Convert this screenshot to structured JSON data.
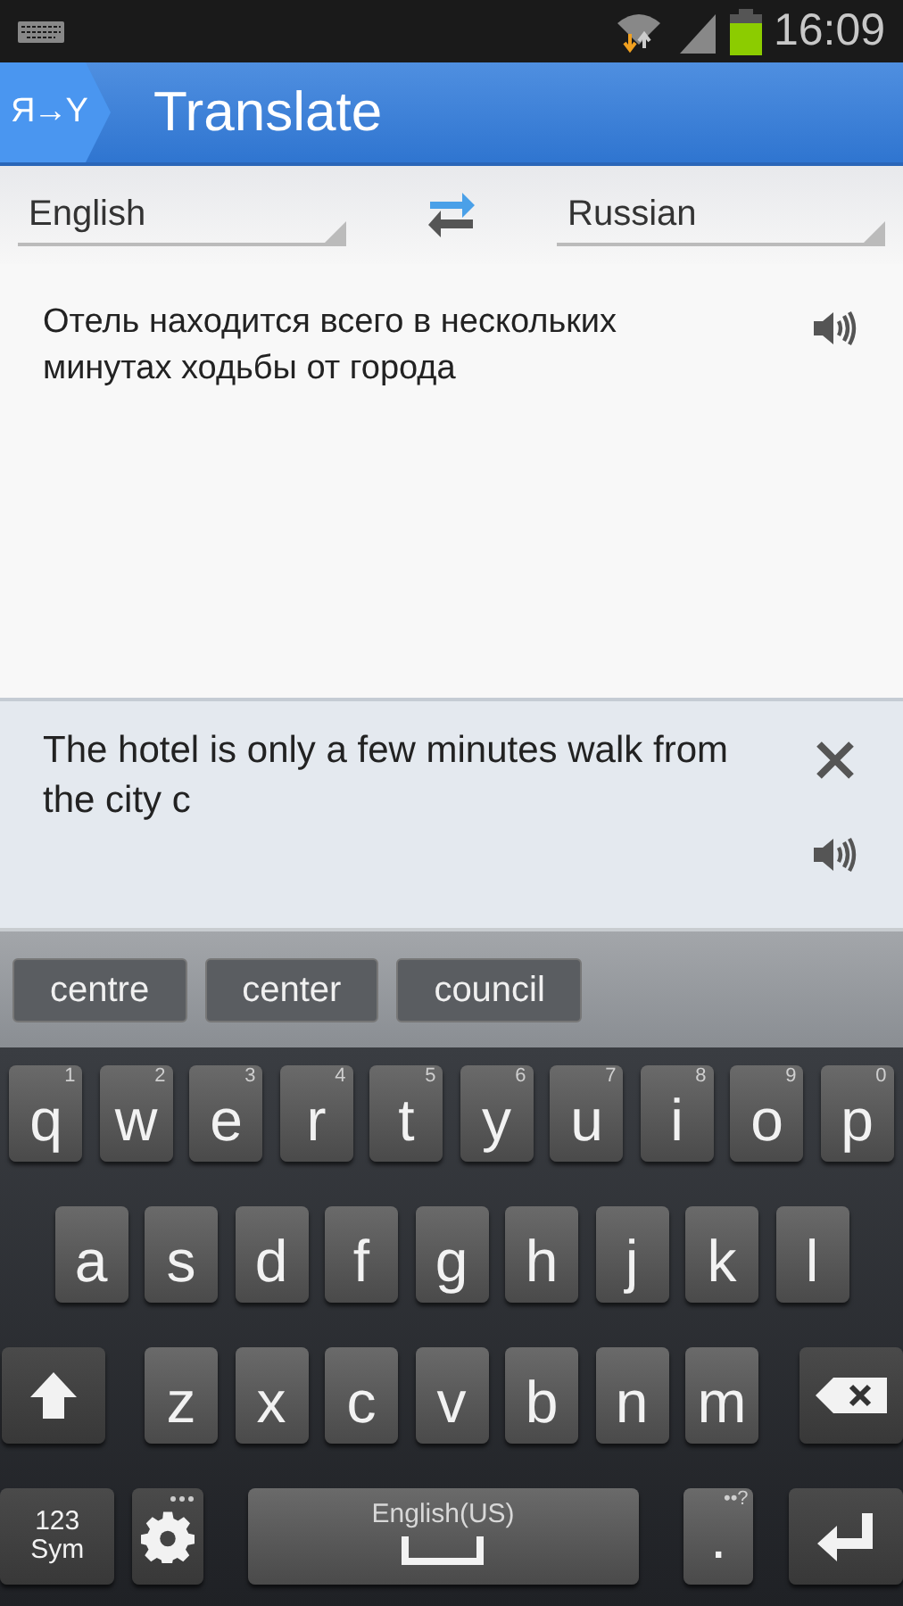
{
  "status_bar": {
    "time": "16:09"
  },
  "app_bar": {
    "logo": "Я→Y",
    "title": "Translate"
  },
  "languages": {
    "source": "English",
    "target": "Russian"
  },
  "translation": {
    "text": "Отель находится всего в нескольких минутах ходьбы от города"
  },
  "input": {
    "value": "The hotel is only a few minutes walk from the city c"
  },
  "suggestions": [
    "centre",
    "center",
    "council"
  ],
  "keyboard": {
    "row_1": [
      {
        "kind": "letter",
        "label": "q",
        "hint": "1"
      },
      {
        "kind": "letter",
        "label": "w",
        "hint": "2"
      },
      {
        "kind": "letter",
        "label": "e",
        "hint": "3"
      },
      {
        "kind": "letter",
        "label": "r",
        "hint": "4"
      },
      {
        "kind": "letter",
        "label": "t",
        "hint": "5"
      },
      {
        "kind": "letter",
        "label": "y",
        "hint": "6"
      },
      {
        "kind": "letter",
        "label": "u",
        "hint": "7"
      },
      {
        "kind": "letter",
        "label": "i",
        "hint": "8"
      },
      {
        "kind": "letter",
        "label": "o",
        "hint": "9"
      },
      {
        "kind": "letter",
        "label": "p",
        "hint": "0"
      }
    ],
    "row_2": [
      {
        "kind": "letter",
        "label": "a"
      },
      {
        "kind": "letter",
        "label": "s"
      },
      {
        "kind": "letter",
        "label": "d"
      },
      {
        "kind": "letter",
        "label": "f"
      },
      {
        "kind": "letter",
        "label": "g"
      },
      {
        "kind": "letter",
        "label": "h"
      },
      {
        "kind": "letter",
        "label": "j"
      },
      {
        "kind": "letter",
        "label": "k"
      },
      {
        "kind": "letter",
        "label": "l"
      }
    ],
    "row_3": [
      {
        "kind": "shift"
      },
      {
        "kind": "letter",
        "label": "z"
      },
      {
        "kind": "letter",
        "label": "x"
      },
      {
        "kind": "letter",
        "label": "c"
      },
      {
        "kind": "letter",
        "label": "v"
      },
      {
        "kind": "letter",
        "label": "b"
      },
      {
        "kind": "letter",
        "label": "n"
      },
      {
        "kind": "letter",
        "label": "m"
      },
      {
        "kind": "backspace"
      }
    ],
    "row_4": [
      {
        "kind": "sym",
        "label": "123 Sym"
      },
      {
        "kind": "settings"
      },
      {
        "kind": "space",
        "label": "English(US)"
      },
      {
        "kind": "period",
        "label": ".",
        "hint": "••?"
      },
      {
        "kind": "enter"
      }
    ]
  }
}
